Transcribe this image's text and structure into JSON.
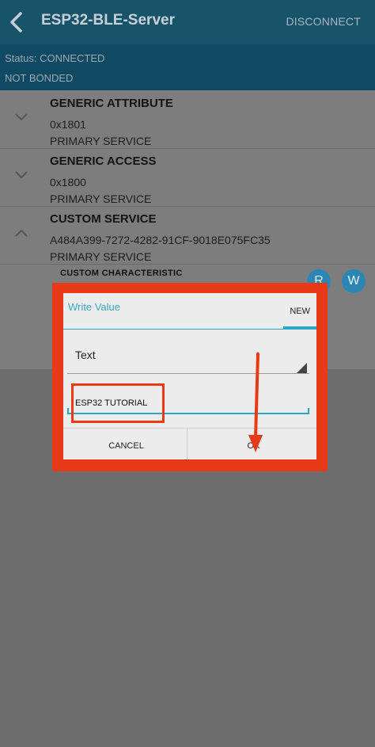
{
  "appbar": {
    "title": "ESP32-BLE-Server",
    "disconnect_label": "DISCONNECT",
    "back_icon": "chevron-left-icon"
  },
  "status": {
    "connection": "Status: CONNECTED",
    "bond": "NOT BONDED"
  },
  "services": [
    {
      "name": "GENERIC ATTRIBUTE",
      "uuid": "0x1801",
      "type": "PRIMARY SERVICE",
      "expanded": false
    },
    {
      "name": "GENERIC ACCESS",
      "uuid": "0x1800",
      "type": "PRIMARY SERVICE",
      "expanded": false
    },
    {
      "name": "CUSTOM SERVICE",
      "uuid": "A484A399-7272-4282-91CF-9018E075FC35",
      "type": "PRIMARY SERVICE",
      "expanded": true
    }
  ],
  "characteristic": {
    "name": "CUSTOM CHARACTERISTIC",
    "read_button": "R",
    "write_button": "W"
  },
  "dialog": {
    "title": "Write Value",
    "tab_label": "NEW",
    "format_selected": "Text",
    "value": "ESP32 TUTORIAL",
    "cancel_label": "CANCEL",
    "ok_label": "OK"
  },
  "colors": {
    "appbar": "#17546a",
    "accent": "#2aa7c2",
    "annotation": "#e83a17"
  }
}
